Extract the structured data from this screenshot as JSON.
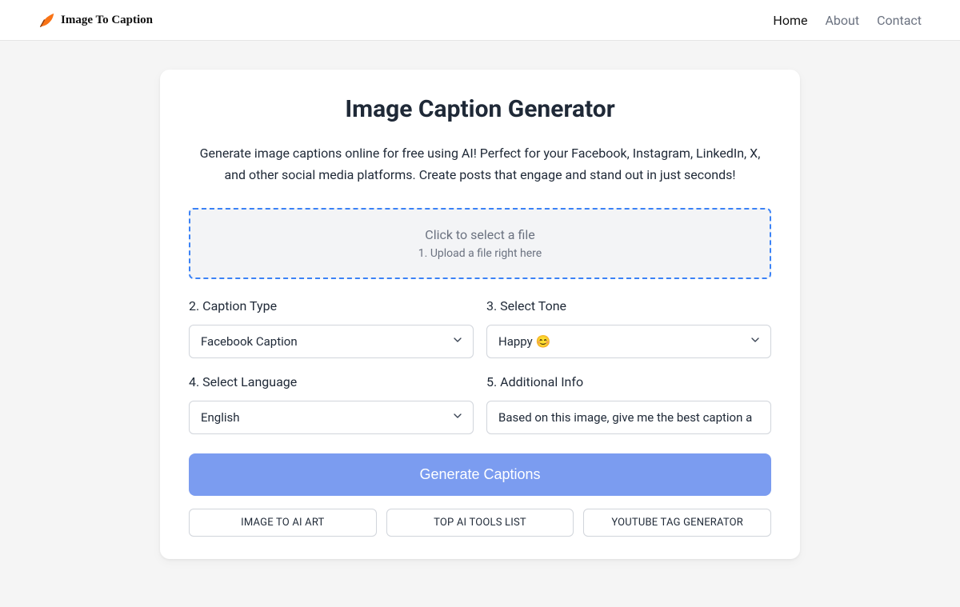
{
  "header": {
    "brand": "Image To Caption",
    "nav": {
      "home": "Home",
      "about": "About",
      "contact": "Contact"
    }
  },
  "card": {
    "title": "Image Caption Generator",
    "subtitle": "Generate image captions online for free using AI! Perfect for your Facebook, Instagram, LinkedIn, X, and other social media platforms. Create posts that engage and stand out in just seconds!",
    "dropzone": {
      "main": "Click to select a file",
      "sub": "1. Upload a file right here"
    },
    "labels": {
      "caption_type": "2. Caption Type",
      "tone": "3. Select Tone",
      "language": "4. Select Language",
      "additional": "5. Additional Info"
    },
    "values": {
      "caption_type": "Facebook Caption",
      "tone": "Happy 😊",
      "language": "English",
      "additional": "Based on this image, give me the best caption a"
    },
    "generate_label": "Generate Captions",
    "link_buttons": {
      "art": "IMAGE TO AI ART",
      "tools": "TOP AI TOOLS LIST",
      "youtube": "YOUTUBE TAG GENERATOR"
    }
  }
}
